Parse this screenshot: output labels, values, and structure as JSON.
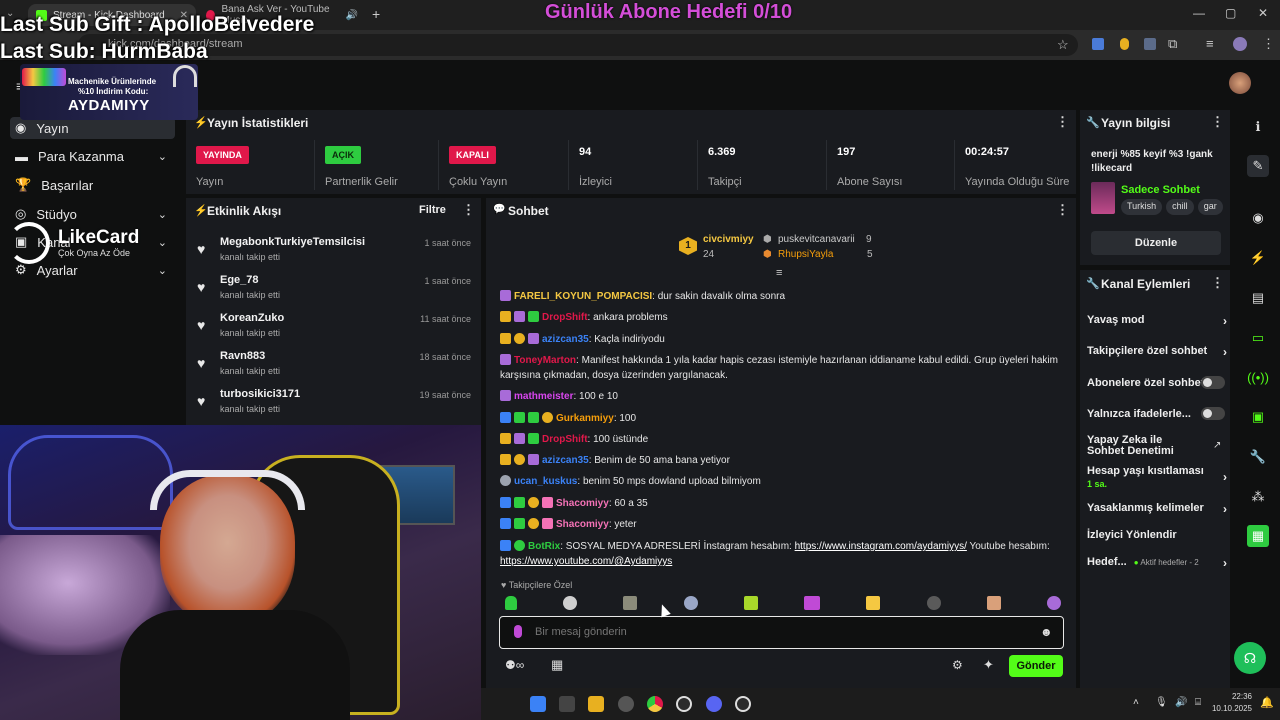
{
  "browser": {
    "tabs": [
      {
        "label": "Stream - Kick Dashboard",
        "active": true
      },
      {
        "label": "Bana Ask Ver - YouTube Music",
        "active": false
      }
    ],
    "url": "kick.com/dashboard/stream"
  },
  "overlay": {
    "last_sub_gift": "Last Sub Gift : ApolloBelvedere",
    "last_sub": "Last Sub: HurmBaba",
    "goal": "Günlük Abone Hedefi 0/10",
    "promo_line1": "Machenike Ürünlerinde",
    "promo_line2": "%10 İndirim Kodu:",
    "promo_code": "AYDAMIYY",
    "likecard_brand": "LikeCard",
    "likecard_tagline": "Çok Oyna  Az Öde"
  },
  "sidebar": {
    "items": [
      {
        "label": "Yayın",
        "active": true
      },
      {
        "label": "Para Kazanma",
        "chevron": true
      },
      {
        "label": "Başarılar"
      },
      {
        "label": "Stüdyo",
        "chevron": true
      },
      {
        "label": "Kanal",
        "chevron": true
      },
      {
        "label": "Ayarlar",
        "chevron": true
      }
    ]
  },
  "stats": {
    "title": "Yayın İstatistikleri",
    "cells": [
      {
        "badge": "YAYINDA",
        "badge_color": "#e0184a",
        "label": "Yayın"
      },
      {
        "badge": "AÇIK",
        "badge_color": "#2ecc40",
        "label": "Partnerlik Gelir"
      },
      {
        "badge": "KAPALI",
        "badge_color": "#e0184a",
        "label": "Çoklu Yayın"
      },
      {
        "value": "94",
        "label": "İzleyici"
      },
      {
        "value": "6.369",
        "label": "Takipçi"
      },
      {
        "value": "197",
        "label": "Abone Sayısı"
      },
      {
        "value": "00:24:57",
        "label": "Yayında Olduğu Süre"
      }
    ]
  },
  "activity": {
    "title": "Etkinlik Akışı",
    "filter": "Filtre",
    "items": [
      {
        "name": "MegabonkTurkiyeTemsilcisi",
        "action": "kanalı takip etti",
        "time": "1 saat önce"
      },
      {
        "name": "Ege_78",
        "action": "kanalı takip etti",
        "time": "1 saat önce"
      },
      {
        "name": "KoreanZuko",
        "action": "kanalı takip etti",
        "time": "11 saat önce"
      },
      {
        "name": "Ravn883",
        "action": "kanalı takip etti",
        "time": "18 saat önce"
      },
      {
        "name": "turbosikici3171",
        "action": "kanalı takip etti",
        "time": "19 saat önce"
      }
    ]
  },
  "chat": {
    "title": "Sohbet",
    "leaderboard": {
      "rank": "1",
      "top_name": "civcivmiyy",
      "top_count": "24",
      "second_name": "puskevitcanavarii",
      "second_count": "9",
      "third_name": "RhupsiYayla",
      "third_count": "5"
    },
    "messages": [
      {
        "user": "FARELI_KOYUN_POMPACISI",
        "color": "#f5c842",
        "text": "dur sakin davalık olma sonra",
        "icons": [
          "#a86bd8"
        ]
      },
      {
        "user": "DropShift",
        "color": "#e0184a",
        "text": "ankara problems",
        "icons": [
          "#e8b020",
          "#a86bd8",
          "#2ecc40"
        ]
      },
      {
        "user": "azizcan35",
        "color": "#3b82f6",
        "text": "Kaçla indiriyodu",
        "icons": [
          "#e8b020",
          "#e8b020",
          "#a86bd8"
        ]
      },
      {
        "user": "ToneyMarton",
        "color": "#e0184a",
        "text": "Manifest hakkında 1 yıla kadar hapis cezası istemiyle hazırlanan iddianame kabul edildi. Grup üyeleri hakim karşısına çıkmadan, dosya üzerinden yargılanacak.",
        "icons": [
          "#a86bd8"
        ]
      },
      {
        "user": "mathmeister",
        "color": "#d946ef",
        "text": "100 e 10",
        "icons": [
          "#a86bd8"
        ]
      },
      {
        "user": "Gurkanmiyy",
        "color": "#f59e0b",
        "text": "100",
        "icons": [
          "#3b82f6",
          "#2ecc40",
          "#2ecc40",
          "#e8b020"
        ]
      },
      {
        "user": "DropShift",
        "color": "#e0184a",
        "text": "100 üstünde",
        "icons": [
          "#e8b020",
          "#a86bd8",
          "#2ecc40"
        ]
      },
      {
        "user": "azizcan35",
        "color": "#3b82f6",
        "text": "Benim de 50 ama bana yetiyor",
        "icons": [
          "#e8b020",
          "#e8b020",
          "#a86bd8"
        ]
      },
      {
        "user": "ucan_kuskus",
        "color": "#3b82f6",
        "text": "benim 50 mps dowland upload bilmiyom",
        "icons": [
          "#9ca3af"
        ]
      },
      {
        "user": "Shacomiyy",
        "color": "#f472b6",
        "text": "60 a 35",
        "icons": [
          "#3b82f6",
          "#2ecc40",
          "#e8b020",
          "#f472b6"
        ]
      },
      {
        "user": "Shacomiyy",
        "color": "#f472b6",
        "text": "yeter",
        "icons": [
          "#3b82f6",
          "#2ecc40",
          "#e8b020",
          "#f472b6"
        ]
      },
      {
        "user": "BotRix",
        "color": "#2ecc40",
        "text_before": "SOSYAL MEDYA ADRESLERİ İnstagram hesabım: ",
        "link1": "https://www.instagram.com/aydamiyys/",
        "text_mid": " Youtube hesabım: ",
        "link2": "https://www.youtube.com/@Aydamiyys",
        "icons": [
          "#3b82f6",
          "#2ecc40"
        ]
      }
    ],
    "followers_only_label": "Takipçilere Özel",
    "input_placeholder": "Bir mesaj gönderin",
    "send_label": "Gönder"
  },
  "stream_info": {
    "title": "Yayın bilgisi",
    "stream_title": "enerji %85 keyif %3 !gank !likecard",
    "category": "Sadece Sohbet",
    "tags": [
      "Turkish",
      "chill",
      "gar"
    ],
    "edit_label": "Düzenle"
  },
  "channel_actions": {
    "title": "Kanal Eylemleri",
    "items": [
      {
        "label": "Yavaş mod",
        "type": "chevron"
      },
      {
        "label": "Takipçilere özel sohbet",
        "type": "chevron"
      },
      {
        "label": "Abonelere özel sohbet",
        "type": "toggle"
      },
      {
        "label": "Yalnızca ifadelerle...",
        "type": "toggle"
      },
      {
        "label": "Yapay Zeka ile Sohbet Denetimi",
        "type": "external"
      },
      {
        "label": "Hesap yaşı kısıtlaması",
        "sub": "1 sa.",
        "type": "chevron"
      },
      {
        "label": "Yasaklanmış kelimeler",
        "type": "chevron"
      },
      {
        "label": "İzleyici Yönlendir",
        "type": "none"
      },
      {
        "label": "Hedef...",
        "sub": "Aktif hedefler - 2",
        "type": "chevron"
      }
    ]
  },
  "taskbar": {
    "time": "22:36",
    "date": "10.10.2025"
  },
  "colors": {
    "kick_green": "#53fc18",
    "live_red": "#e0184a"
  }
}
